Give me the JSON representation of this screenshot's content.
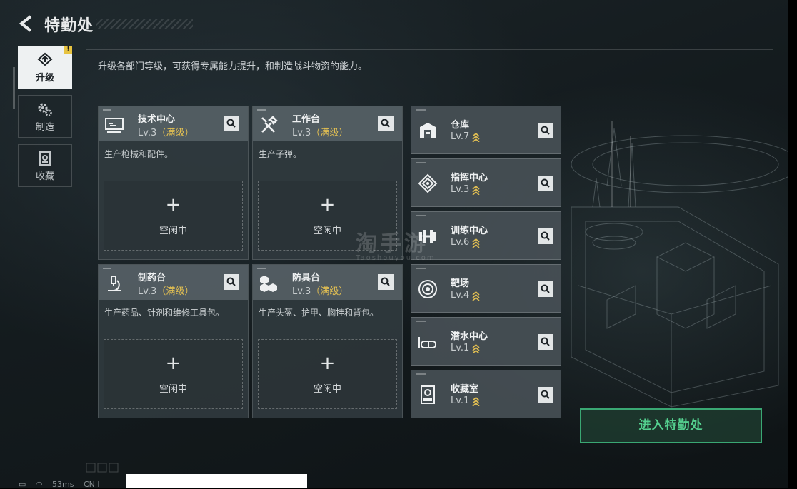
{
  "header": {
    "title": "特勤处"
  },
  "sidebar": {
    "tabs": [
      {
        "label": "升级",
        "icon": "upgrade-icon",
        "active": true,
        "badge": "!"
      },
      {
        "label": "制造",
        "icon": "gears-icon",
        "active": false
      },
      {
        "label": "收藏",
        "icon": "collection-icon",
        "active": false
      }
    ]
  },
  "description": "升级各部门等级，可获得专属能力提升，和制造战斗物资的能力。",
  "workshops": [
    {
      "name": "技术中心",
      "level": "Lv.3",
      "max": "（满级）",
      "desc": "生产枪械和配件。",
      "slot_plus": "+",
      "slot_status": "空闲中",
      "icon": "computer-icon"
    },
    {
      "name": "工作台",
      "level": "Lv.3",
      "max": "（满级）",
      "desc": "生产子弹。",
      "slot_plus": "+",
      "slot_status": "空闲中",
      "icon": "tools-icon"
    },
    {
      "name": "制药台",
      "level": "Lv.3",
      "max": "（满级）",
      "desc": "生产药品、针剂和维修工具包。",
      "slot_plus": "+",
      "slot_status": "空闲中",
      "icon": "microscope-icon"
    },
    {
      "name": "防具台",
      "level": "Lv.3",
      "max": "（满级）",
      "desc": "生产头盔、护甲、胸挂和背包。",
      "slot_plus": "+",
      "slot_status": "空闲中",
      "icon": "armor-boxes-icon"
    }
  ],
  "facilities": [
    {
      "name": "仓库",
      "level": "Lv.7",
      "icon": "warehouse-icon"
    },
    {
      "name": "指挥中心",
      "level": "Lv.3",
      "icon": "chip-icon"
    },
    {
      "name": "训练中心",
      "level": "Lv.6",
      "icon": "dumbbell-icon"
    },
    {
      "name": "靶场",
      "level": "Lv.4",
      "icon": "target-icon"
    },
    {
      "name": "潜水中心",
      "level": "Lv.1",
      "icon": "diving-mask-icon"
    },
    {
      "name": "收藏室",
      "level": "Lv.1",
      "icon": "display-case-icon"
    }
  ],
  "enter_button": "进入特勤处",
  "watermark": {
    "main": "淘手游",
    "sub": "Taoshouyou.com"
  },
  "status_bar": {
    "ping": "53ms",
    "region": "CN I"
  },
  "colors": {
    "accent_green": "#54d08f",
    "max_gold": "#e2bf52",
    "badge_yellow": "#e7c341"
  }
}
